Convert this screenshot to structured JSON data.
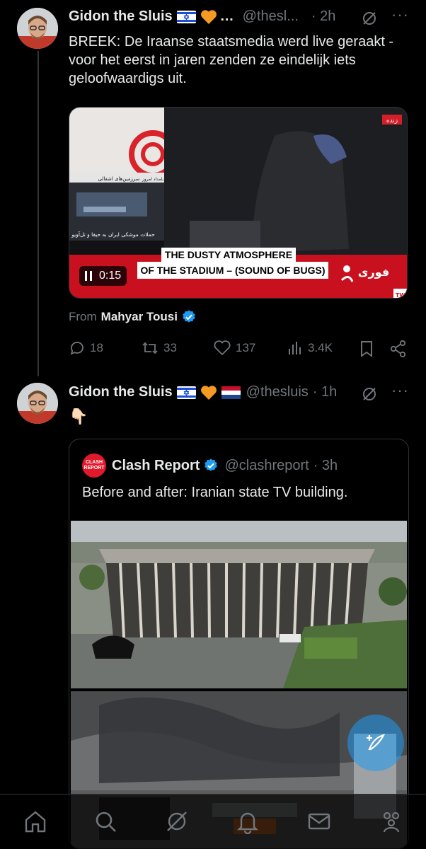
{
  "tweet1": {
    "author_name": "Gidon the Sluis",
    "handle": "@thesl...",
    "time": "· 2h",
    "text": "BREEK: De Iraanse staatsmedia werd live geraakt - voor het eerst in jaren zenden ze eindelijk iets geloofwaardigs uit.",
    "video": {
      "caption_line1": "THE DUSTY ATMOSPHERE",
      "caption_line2": "OF THE STADIUM – (SOUND OF BUGS)",
      "duration": "0:15",
      "live_badge": "زنده",
      "news_ticker": "فوری",
      "news_sub": "حملات موشکی ایران به حیفا و تل‌آویو",
      "news_head": "سرزمین‌های اشغالی",
      "news_tag": "بامداد امروز",
      "corner": "TW"
    },
    "from_label": "From",
    "from_name": "Mahyar Tousi",
    "replies": "18",
    "reposts": "33",
    "likes": "137",
    "views": "3.4K"
  },
  "tweet2": {
    "author_name": "Gidon the Sluis",
    "handle": "@thesluis",
    "time": "· 1h",
    "text": "👇🏻",
    "quote": {
      "author_name": "Clash Report",
      "handle": "@clashreport",
      "time": "· 3h",
      "text": "Before and after: Iranian state TV building.",
      "avatar_line1": "CLASH",
      "avatar_line2": "REPORT"
    }
  },
  "colors": {
    "background": "#000000",
    "text_primary": "#e7e9ea",
    "text_secondary": "#71767b",
    "verified_blue": "#1d9bf0",
    "clash_red": "#e0192b"
  },
  "icons": {
    "reply": "reply-icon",
    "repost": "repost-icon",
    "like": "heart-icon",
    "views": "views-icon",
    "bookmark": "bookmark-icon",
    "share": "share-icon",
    "grok": "grok-icon",
    "nav": [
      "home-icon",
      "search-icon",
      "grok-icon",
      "notifications-icon",
      "messages-icon",
      "communities-icon"
    ]
  }
}
